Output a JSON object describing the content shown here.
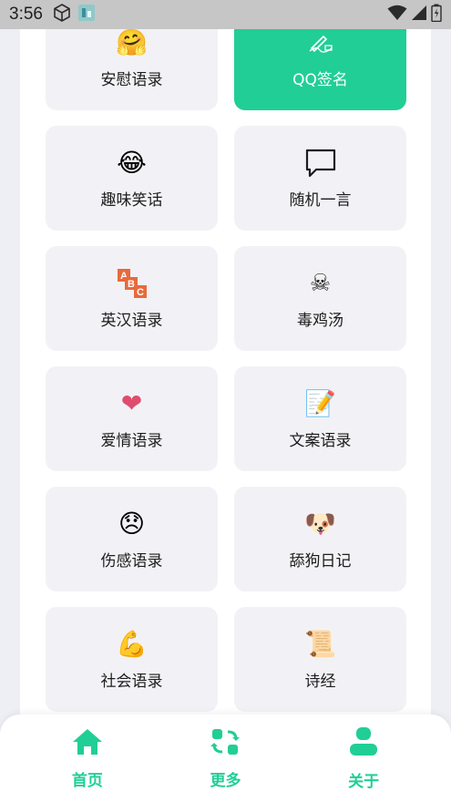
{
  "status_bar": {
    "time": "3:56"
  },
  "grid": {
    "items": [
      {
        "label": "安慰语录",
        "icon": "hugging-face-icon",
        "emoji": "🤗"
      },
      {
        "label": "QQ签名",
        "icon": "signature-pen-icon",
        "emoji": "✍"
      },
      {
        "label": "趣味笑话",
        "icon": "laughing-face-icon",
        "emoji": "😂"
      },
      {
        "label": "随机一言",
        "icon": "speech-bubble-icon",
        "emoji": ""
      },
      {
        "label": "英汉语录",
        "icon": "abc-blocks-icon",
        "emoji": ""
      },
      {
        "label": "毒鸡汤",
        "icon": "skull-crossbones-icon",
        "emoji": "☠"
      },
      {
        "label": "爱情语录",
        "icon": "heart-icon",
        "emoji": "❤"
      },
      {
        "label": "文案语录",
        "icon": "memo-icon",
        "emoji": "📝"
      },
      {
        "label": "伤感语录",
        "icon": "sad-face-icon",
        "emoji": "😞"
      },
      {
        "label": "舔狗日记",
        "icon": "dog-face-icon",
        "emoji": "🐶"
      },
      {
        "label": "社会语录",
        "icon": "flexed-biceps-icon",
        "emoji": "💪"
      },
      {
        "label": "诗经",
        "icon": "scroll-icon",
        "emoji": "📜"
      }
    ],
    "active_index": 1
  },
  "bottom_nav": {
    "accent": "#21CE96",
    "items": [
      {
        "label": "首页",
        "icon": "home-icon"
      },
      {
        "label": "更多",
        "icon": "refresh-grid-icon"
      },
      {
        "label": "关于",
        "icon": "person-icon"
      }
    ]
  }
}
